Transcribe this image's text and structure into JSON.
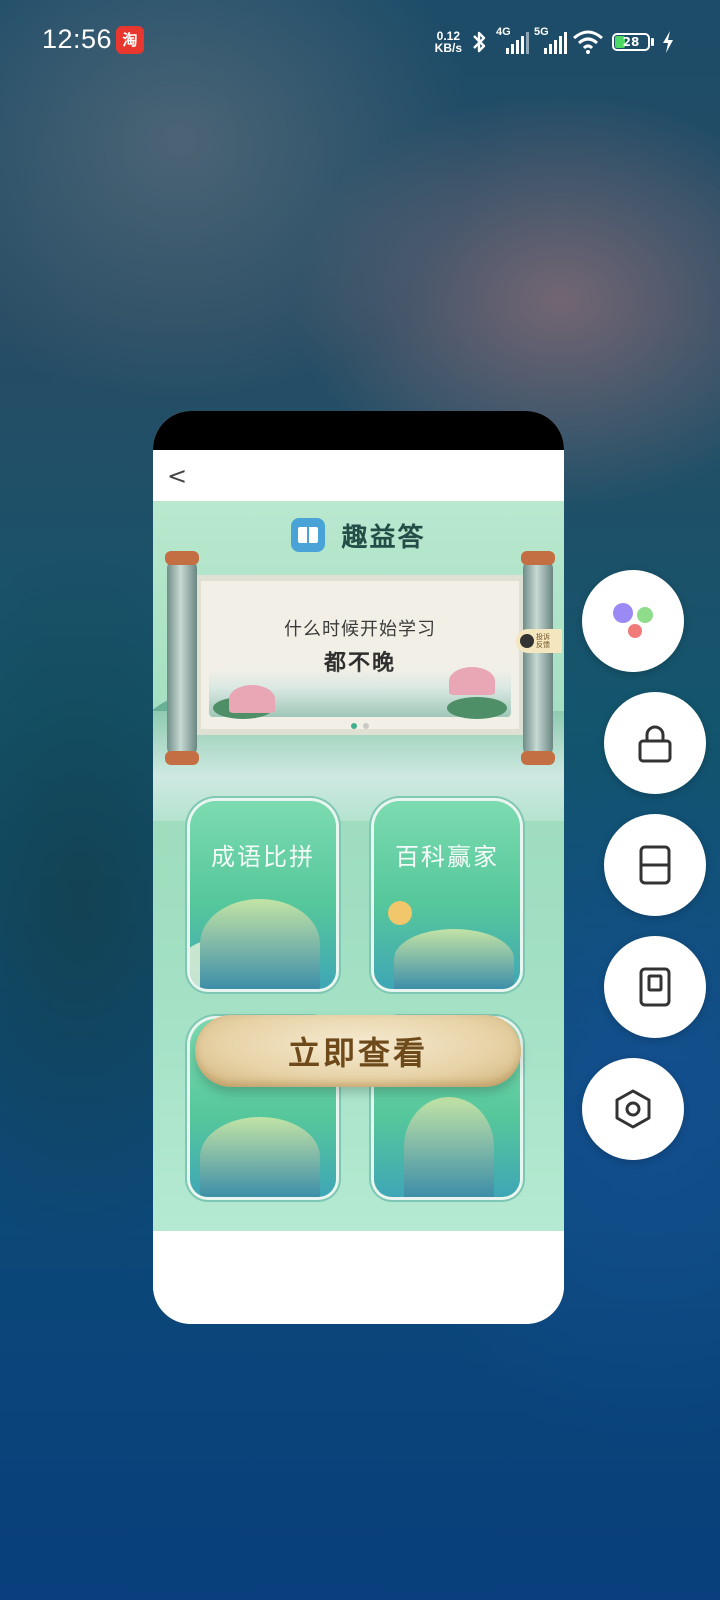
{
  "status_bar": {
    "time": "12:56",
    "app_badge": "淘",
    "net_speed_value": "0.12",
    "net_speed_unit": "KB/s",
    "signal1_label": "4G",
    "signal2_label": "5G",
    "battery_level": "28"
  },
  "app": {
    "back_label": "<",
    "title": "趣益答",
    "banner": {
      "line1": "什么时候开始学习",
      "line2": "都不晚",
      "feedback_line1": "投诉",
      "feedback_line2": "反馈"
    },
    "tiles": [
      {
        "title": "成语比拼"
      },
      {
        "title": "百科赢家"
      }
    ],
    "cta_label": "立即查看"
  },
  "side_actions": [
    {
      "icon": "assistant-icon"
    },
    {
      "icon": "lock-icon"
    },
    {
      "icon": "split-screen-icon"
    },
    {
      "icon": "floating-window-icon"
    },
    {
      "icon": "settings-icon"
    }
  ]
}
